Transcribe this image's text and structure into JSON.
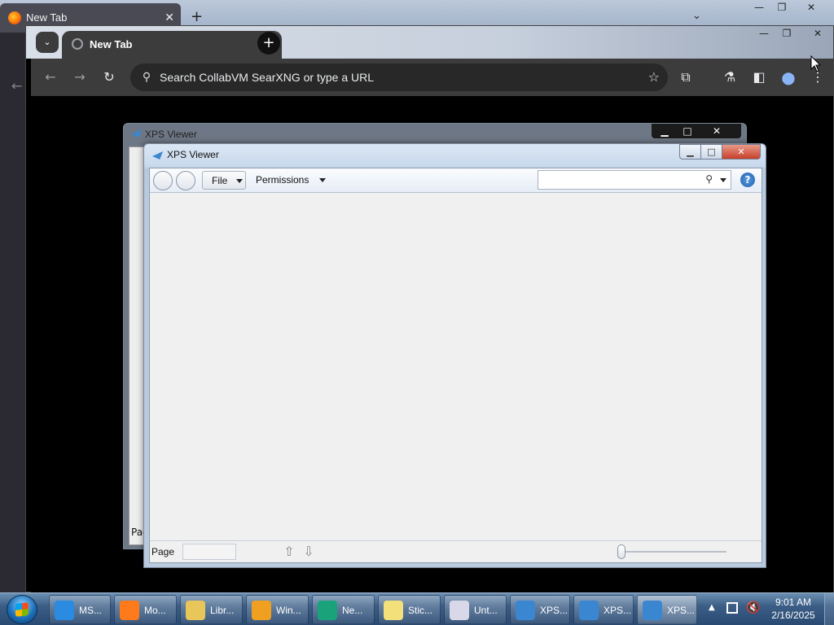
{
  "firefox": {
    "tab_title": "New Tab",
    "new_tab": "+",
    "close_tab": "✕",
    "list_tabs": "⌄",
    "minimize": "—",
    "restore": "❐",
    "close": "✕",
    "back": "←"
  },
  "chrome": {
    "tab_title": "New Tab",
    "close_tab": "✕",
    "new_tab": "+",
    "tab_search": "⌄",
    "omnibox_placeholder": "Search CollabVM SearXNG or type a URL",
    "minimize": "—",
    "restore": "❐",
    "close": "✕",
    "back": "←",
    "forward": "→",
    "reload": "↻",
    "star": "☆",
    "search_glyph": "⚲",
    "extensions": "⧉",
    "labs": "⚗",
    "sidepanel": "◧",
    "profile": "●",
    "menu": "⋮"
  },
  "xps_back": {
    "title": "XPS Viewer",
    "page_label": "Pag",
    "minimize": "▁",
    "maximize": "□",
    "close": "✕"
  },
  "xps_front": {
    "title": "XPS Viewer",
    "minimize": "▁",
    "maximize": "□",
    "close": "✕",
    "file_menu": "File",
    "permissions_menu": "Permissions",
    "search_glyph": "⚲",
    "help": "?",
    "page_label": "Page",
    "page_value": "",
    "prev_page": "⇧",
    "next_page": "⇩",
    "search_value": ""
  },
  "taskbar": {
    "items": [
      {
        "label": "MS...",
        "icon": "ie-icon",
        "color": "#2a8be0"
      },
      {
        "label": "Mo...",
        "icon": "firefox-icon",
        "color": "#ff7a1a"
      },
      {
        "label": "Libr...",
        "icon": "folder-icon",
        "color": "#e8c65a"
      },
      {
        "label": "Win...",
        "icon": "media-player-icon",
        "color": "#f0a020"
      },
      {
        "label": "Ne...",
        "icon": "network-icon",
        "color": "#1aa37a"
      },
      {
        "label": "Stic...",
        "icon": "sticky-notes-icon",
        "color": "#f4e07a"
      },
      {
        "label": "Unt...",
        "icon": "paint-icon",
        "color": "#d8d8e8"
      },
      {
        "label": "XPS...",
        "icon": "xps-icon",
        "color": "#3a86d0"
      },
      {
        "label": "XPS...",
        "icon": "xps-icon",
        "color": "#3a86d0"
      },
      {
        "label": "XPS...",
        "icon": "xps-icon",
        "color": "#3a86d0"
      }
    ],
    "tray_arrow": "▲",
    "volume": "🔇",
    "time": "9:01 AM",
    "date": "2/16/2025"
  }
}
